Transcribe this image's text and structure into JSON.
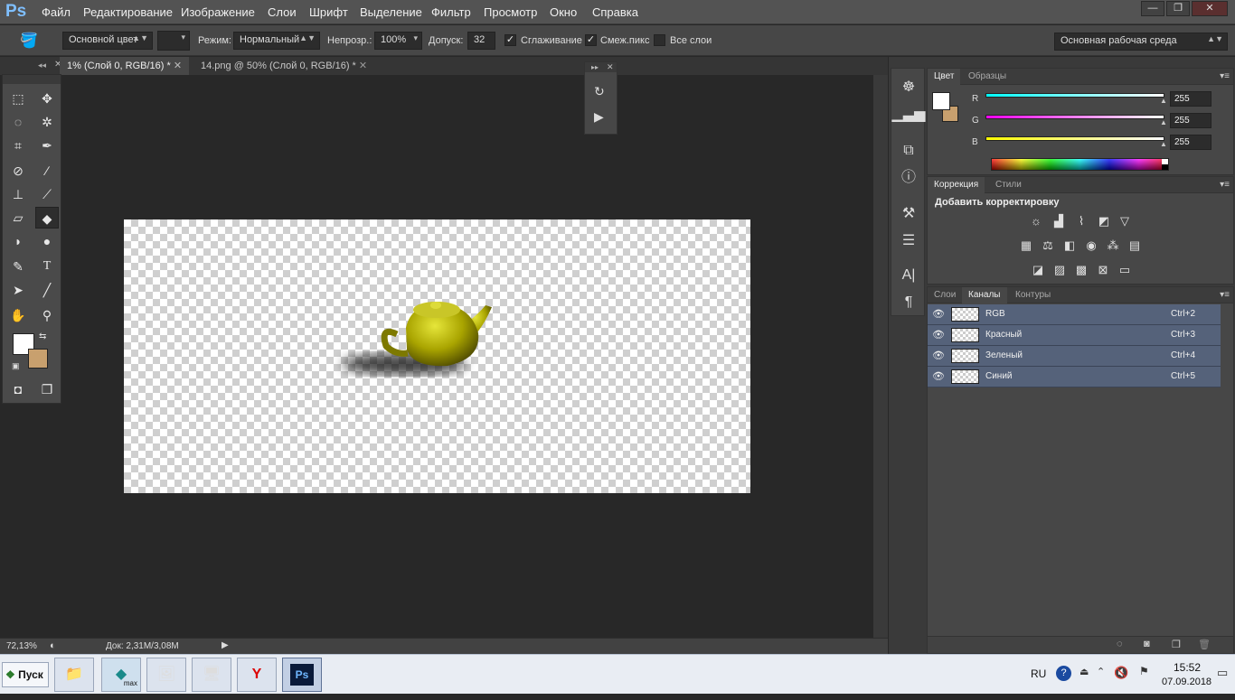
{
  "app": {
    "logo": "Ps"
  },
  "menu": [
    "Файл",
    "Редактирование",
    "Изображение",
    "Слои",
    "Шрифт",
    "Выделение",
    "Фильтр",
    "Просмотр",
    "Окно",
    "Справка"
  ],
  "window_controls": {
    "minimize": "—",
    "maximize": "❐",
    "close": "✕"
  },
  "options": {
    "source_label": "Основной цвет",
    "mode_label": "Режим:",
    "mode_value": "Нормальный",
    "opacity_label": "Непрозр.:",
    "opacity_value": "100%",
    "tolerance_label": "Допуск:",
    "tolerance_value": "32",
    "antialias_label": "Сглаживание",
    "contiguous_label": "Смеж.пикс",
    "all_layers_label": "Все слои",
    "workspace": "Основная рабочая среда"
  },
  "tabs": [
    {
      "label": "1% (Слой 0, RGB/16) *"
    },
    {
      "label": "14.png @ 50% (Слой 0, RGB/16) *"
    }
  ],
  "status": {
    "zoom": "72,13%",
    "doc": "Док: 2,31M/3,08M"
  },
  "color_panel": {
    "tabs": [
      "Цвет",
      "Образцы"
    ],
    "channels": [
      {
        "label": "R",
        "value": "255",
        "color": "#00ffff"
      },
      {
        "label": "G",
        "value": "255",
        "color": "#ff00ff"
      },
      {
        "label": "B",
        "value": "255",
        "color": "#ffff00"
      }
    ],
    "foreground": "#ffffff",
    "background": "#c8a06e"
  },
  "adjust_panel": {
    "tabs": [
      "Коррекция",
      "Стили"
    ],
    "title": "Добавить корректировку"
  },
  "channels_panel": {
    "tabs": [
      "Слои",
      "Каналы",
      "Контуры"
    ],
    "rows": [
      {
        "name": "RGB",
        "shortcut": "Ctrl+2"
      },
      {
        "name": "Красный",
        "shortcut": "Ctrl+3"
      },
      {
        "name": "Зеленый",
        "shortcut": "Ctrl+4"
      },
      {
        "name": "Синий",
        "shortcut": "Ctrl+5"
      }
    ]
  },
  "taskbar": {
    "start": "Пуск",
    "lang": "RU",
    "time": "15:52",
    "date": "07.09.2018",
    "max_label": "max"
  }
}
